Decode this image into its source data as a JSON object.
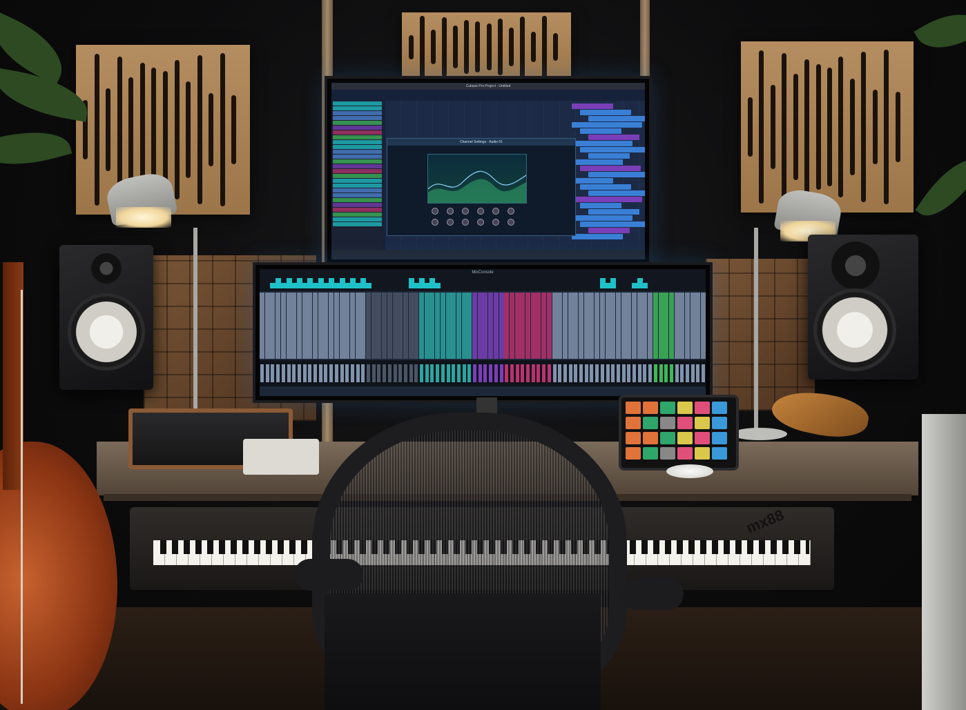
{
  "daw_title": "Cubase Pro Project - Untitled",
  "eq_window_title": "Channel Settings - Audio 01",
  "mixer_title": "MixConsole",
  "keyboard_brand": "mx88",
  "colors": {
    "screen_bg": "#16213a",
    "accent_cyan": "#1fc1c8",
    "accent_purple": "#7a3fb8",
    "accent_magenta": "#b8336e",
    "accent_green": "#3fb85a"
  }
}
